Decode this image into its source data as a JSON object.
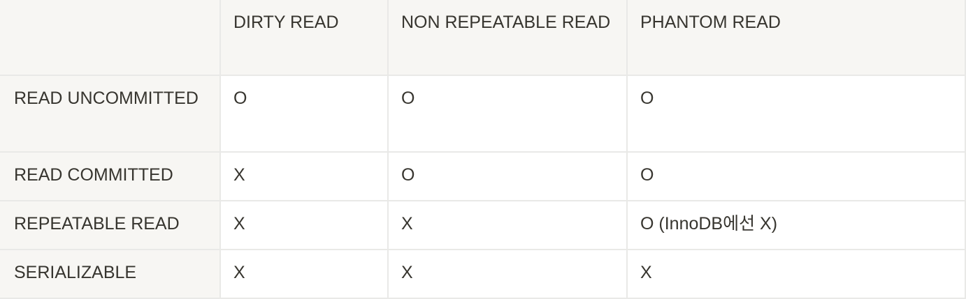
{
  "table": {
    "header": {
      "corner": "",
      "columns": [
        "DIRTY READ",
        "NON REPEATABLE READ",
        "PHANTOM READ"
      ]
    },
    "rows": [
      {
        "label": "READ UNCOMMITTED",
        "cells": [
          "O",
          "O",
          "O"
        ]
      },
      {
        "label": "READ COMMITTED",
        "cells": [
          "X",
          "O",
          "O"
        ]
      },
      {
        "label": "REPEATABLE READ",
        "cells": [
          "X",
          "X",
          "O (InnoDB에선 X)"
        ]
      },
      {
        "label": "SERIALIZABLE",
        "cells": [
          "X",
          "X",
          "X"
        ]
      }
    ]
  },
  "colors": {
    "header_background": "#f7f6f3",
    "cell_background": "#ffffff",
    "border": "#e9e9e7",
    "text": "#37352f"
  }
}
